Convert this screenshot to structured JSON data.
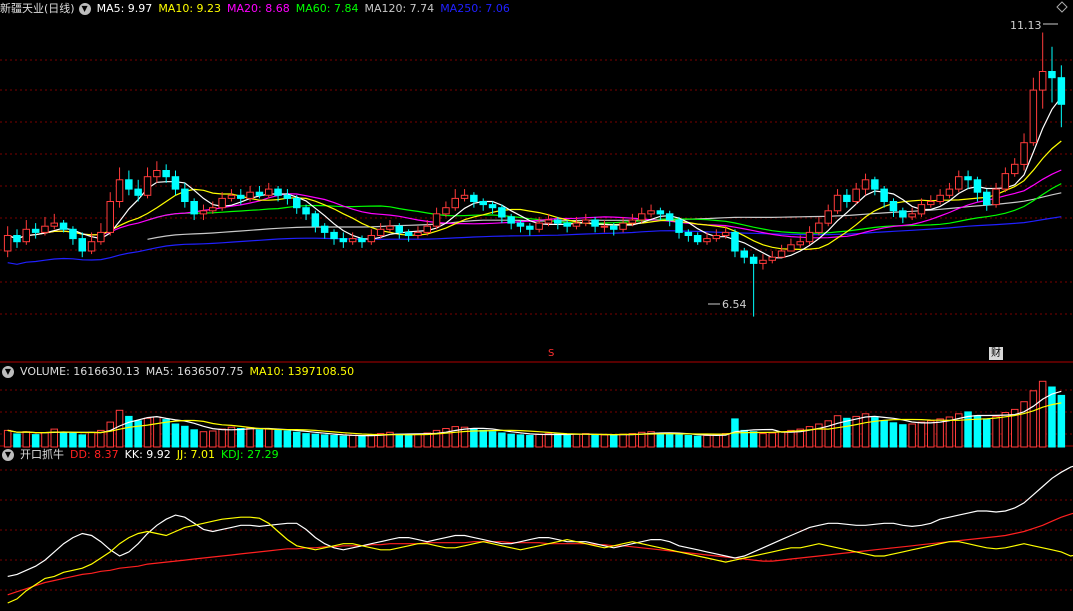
{
  "colors": {
    "background": "#000000",
    "up": "#ff3b3b",
    "down": "#00ffff",
    "grid": "#7a0000",
    "ma5": "#ffffff",
    "ma10": "#ffff00",
    "ma20": "#ff00ff",
    "ma60": "#00ff00",
    "ma120": "#c8c8c8",
    "ma250": "#2020ff",
    "kdj_dd": "#ff2020",
    "kdj_kk": "#ffffff",
    "kdj_jj": "#ffff00",
    "kdj_kdj": "#00ff00"
  },
  "price_panel": {
    "stock_name": "新疆天业(日线)",
    "collapse_icon": "chevron-down-icon",
    "ma_labels": [
      {
        "key": "ma5",
        "text": "MA5: 9.97"
      },
      {
        "key": "ma10",
        "text": "MA10: 9.23"
      },
      {
        "key": "ma20",
        "text": "MA20: 8.68"
      },
      {
        "key": "ma60",
        "text": "MA60: 7.84"
      },
      {
        "key": "ma120",
        "text": "MA120: 7.74"
      },
      {
        "key": "ma250",
        "text": "MA250: 7.06"
      }
    ],
    "high_label": "11.13",
    "low_label": "6.54",
    "marker_s": "S",
    "marker_finance": "财"
  },
  "volume_panel": {
    "labels": [
      {
        "key": "vol",
        "text": "VOLUME: 1616630.13"
      },
      {
        "key": "ma5",
        "text": "MA5: 1636507.75"
      },
      {
        "key": "ma10",
        "text": "MA10: 1397108.50"
      }
    ]
  },
  "indicator_panel": {
    "name": "开口抓牛",
    "labels": [
      {
        "key": "dd",
        "text": "DD: 8.37"
      },
      {
        "key": "kk",
        "text": "KK: 9.92"
      },
      {
        "key": "jj",
        "text": "JJ: 7.01"
      },
      {
        "key": "kdj",
        "text": "KDJ: 27.29"
      }
    ]
  },
  "chart_data": [
    {
      "type": "candlestick",
      "ylim": [
        6.0,
        11.3
      ],
      "count": 102,
      "close": [
        7.85,
        7.75,
        7.95,
        7.9,
        8.0,
        8.05,
        7.95,
        7.8,
        7.6,
        7.75,
        7.9,
        8.4,
        8.75,
        8.6,
        8.5,
        8.8,
        8.9,
        8.8,
        8.6,
        8.4,
        8.2,
        8.25,
        8.3,
        8.45,
        8.5,
        8.45,
        8.55,
        8.5,
        8.6,
        8.5,
        8.45,
        8.3,
        8.2,
        8.0,
        7.9,
        7.8,
        7.75,
        7.8,
        7.75,
        7.85,
        7.95,
        8.0,
        7.9,
        7.85,
        7.9,
        8.0,
        8.2,
        8.3,
        8.45,
        8.5,
        8.4,
        8.35,
        8.3,
        8.15,
        8.05,
        8.0,
        7.95,
        8.05,
        8.1,
        8.05,
        8.0,
        8.05,
        8.1,
        8.0,
        8.0,
        7.95,
        8.05,
        8.1,
        8.2,
        8.25,
        8.2,
        8.1,
        7.9,
        7.85,
        7.75,
        7.8,
        7.85,
        7.9,
        7.6,
        7.5,
        7.4,
        7.45,
        7.5,
        7.6,
        7.7,
        7.75,
        7.9,
        8.05,
        8.25,
        8.5,
        8.4,
        8.6,
        8.75,
        8.6,
        8.4,
        8.25,
        8.15,
        8.2,
        8.35,
        8.4,
        8.5,
        8.6,
        8.8,
        8.75,
        8.55,
        8.35,
        8.6,
        8.85,
        9.0,
        9.35,
        10.2,
        10.5,
        10.4,
        9.97
      ],
      "open": [
        7.6,
        7.85,
        7.75,
        7.95,
        7.9,
        8.0,
        8.05,
        7.95,
        7.8,
        7.6,
        7.75,
        7.9,
        8.4,
        8.75,
        8.6,
        8.5,
        8.8,
        8.9,
        8.8,
        8.6,
        8.4,
        8.2,
        8.25,
        8.3,
        8.45,
        8.5,
        8.45,
        8.55,
        8.5,
        8.6,
        8.5,
        8.45,
        8.3,
        8.2,
        8.0,
        7.9,
        7.8,
        7.75,
        7.8,
        7.75,
        7.85,
        7.95,
        8.0,
        7.9,
        7.85,
        7.9,
        8.0,
        8.2,
        8.3,
        8.45,
        8.5,
        8.4,
        8.35,
        8.3,
        8.15,
        8.05,
        8.0,
        7.95,
        8.05,
        8.1,
        8.05,
        8.0,
        8.05,
        8.1,
        8.0,
        8.0,
        7.95,
        8.05,
        8.1,
        8.2,
        8.25,
        8.2,
        8.1,
        7.9,
        7.85,
        7.75,
        7.8,
        7.85,
        7.9,
        7.6,
        7.5,
        7.4,
        7.45,
        7.5,
        7.6,
        7.7,
        7.75,
        7.9,
        8.05,
        8.25,
        8.5,
        8.4,
        8.6,
        8.75,
        8.6,
        8.4,
        8.25,
        8.15,
        8.2,
        8.35,
        8.4,
        8.5,
        8.6,
        8.8,
        8.75,
        8.55,
        8.35,
        8.6,
        8.85,
        9.0,
        9.35,
        10.2,
        10.5,
        10.4
      ],
      "high": [
        8.0,
        7.95,
        8.1,
        8.05,
        8.15,
        8.2,
        8.1,
        8.0,
        7.9,
        7.9,
        8.05,
        8.55,
        8.95,
        8.9,
        8.75,
        8.95,
        9.05,
        9.0,
        8.9,
        8.7,
        8.45,
        8.35,
        8.4,
        8.55,
        8.6,
        8.6,
        8.65,
        8.65,
        8.7,
        8.65,
        8.6,
        8.5,
        8.35,
        8.25,
        8.05,
        7.95,
        7.9,
        7.9,
        7.85,
        7.95,
        8.05,
        8.1,
        8.05,
        7.95,
        8.0,
        8.1,
        8.3,
        8.4,
        8.6,
        8.6,
        8.55,
        8.45,
        8.4,
        8.35,
        8.2,
        8.1,
        8.05,
        8.15,
        8.2,
        8.15,
        8.1,
        8.15,
        8.2,
        8.15,
        8.1,
        8.05,
        8.15,
        8.2,
        8.3,
        8.35,
        8.3,
        8.25,
        8.15,
        7.95,
        7.9,
        7.9,
        7.95,
        8.0,
        7.95,
        7.65,
        7.55,
        7.55,
        7.6,
        7.7,
        7.8,
        7.85,
        8.0,
        8.15,
        8.35,
        8.6,
        8.6,
        8.7,
        8.85,
        8.8,
        8.65,
        8.45,
        8.3,
        8.3,
        8.45,
        8.5,
        8.6,
        8.7,
        8.9,
        8.9,
        8.8,
        8.6,
        8.7,
        8.95,
        9.1,
        9.5,
        10.4,
        11.13,
        10.9,
        10.6
      ],
      "low": [
        7.5,
        7.65,
        7.7,
        7.8,
        7.85,
        7.95,
        7.9,
        7.7,
        7.5,
        7.55,
        7.7,
        7.85,
        8.3,
        8.5,
        8.4,
        8.45,
        8.7,
        8.7,
        8.5,
        8.3,
        8.1,
        8.1,
        8.2,
        8.25,
        8.4,
        8.35,
        8.4,
        8.45,
        8.45,
        8.4,
        8.35,
        8.2,
        8.1,
        7.9,
        7.8,
        7.7,
        7.65,
        7.7,
        7.65,
        7.7,
        7.8,
        7.9,
        7.8,
        7.75,
        7.8,
        7.85,
        7.95,
        8.15,
        8.25,
        8.4,
        8.3,
        8.25,
        8.2,
        8.05,
        7.95,
        7.9,
        7.85,
        7.9,
        8.0,
        7.95,
        7.9,
        7.95,
        8.0,
        7.9,
        7.9,
        7.85,
        7.9,
        8.0,
        8.05,
        8.15,
        8.1,
        8.0,
        7.8,
        7.75,
        7.7,
        7.7,
        7.75,
        7.8,
        7.5,
        7.4,
        6.54,
        7.3,
        7.4,
        7.5,
        7.6,
        7.65,
        7.7,
        7.85,
        8.0,
        8.2,
        8.3,
        8.35,
        8.5,
        8.5,
        8.3,
        8.15,
        8.05,
        8.1,
        8.15,
        8.3,
        8.35,
        8.45,
        8.55,
        8.6,
        8.4,
        8.25,
        8.3,
        8.55,
        8.8,
        8.9,
        9.3,
        9.9,
        10.0,
        9.6
      ]
    },
    {
      "type": "bar",
      "series_name": "VOLUME",
      "ylim": [
        0,
        2100000
      ],
      "values": [
        520000,
        410000,
        480000,
        390000,
        450000,
        560000,
        470000,
        430000,
        380000,
        460000,
        520000,
        780000,
        1150000,
        960000,
        820000,
        900000,
        940000,
        860000,
        720000,
        650000,
        540000,
        480000,
        500000,
        560000,
        620000,
        580000,
        600000,
        540000,
        560000,
        520000,
        500000,
        460000,
        420000,
        400000,
        380000,
        360000,
        340000,
        360000,
        340000,
        380000,
        420000,
        460000,
        400000,
        380000,
        400000,
        440000,
        520000,
        580000,
        640000,
        620000,
        560000,
        520000,
        480000,
        440000,
        400000,
        380000,
        360000,
        400000,
        420000,
        400000,
        380000,
        400000,
        420000,
        380000,
        380000,
        360000,
        400000,
        420000,
        460000,
        480000,
        440000,
        420000,
        380000,
        360000,
        340000,
        360000,
        380000,
        420000,
        880000,
        520000,
        480000,
        420000,
        440000,
        480000,
        520000,
        560000,
        640000,
        720000,
        820000,
        980000,
        900000,
        960000,
        1040000,
        920000,
        820000,
        760000,
        700000,
        720000,
        780000,
        820000,
        880000,
        940000,
        1040000,
        1100000,
        980000,
        880000,
        960000,
        1080000,
        1180000,
        1420000,
        1760000,
        2060000,
        1880000,
        1616630
      ]
    },
    {
      "type": "line",
      "title": "开口抓牛",
      "ylim": [
        0,
        100
      ],
      "series": [
        {
          "name": "DD",
          "values": [
            10,
            13,
            16,
            19,
            22,
            24,
            26,
            28,
            30,
            31,
            33,
            34,
            36,
            37,
            38,
            40,
            41,
            42,
            43,
            44,
            45,
            46,
            47,
            48,
            49,
            50,
            51,
            52,
            53,
            54,
            55,
            55,
            56,
            56,
            57,
            57,
            58,
            58,
            58,
            59,
            59,
            60,
            60,
            60,
            60,
            61,
            61,
            61,
            61,
            61,
            62,
            62,
            62,
            62,
            61,
            61,
            61,
            61,
            60,
            60,
            60,
            60,
            60,
            59,
            59,
            58,
            58,
            57,
            56,
            55,
            54,
            53,
            52,
            51,
            50,
            49,
            48,
            47,
            46,
            45,
            44,
            43,
            43,
            44,
            45,
            46,
            47,
            48,
            49,
            50,
            51,
            52,
            53,
            54,
            55,
            56,
            57,
            58,
            59,
            60,
            61,
            62,
            63,
            64,
            65,
            66,
            67,
            68,
            70,
            72,
            75,
            78,
            82,
            86,
            89,
            92
          ]
        },
        {
          "name": "KK",
          "values": [
            28,
            30,
            34,
            38,
            44,
            52,
            60,
            66,
            70,
            68,
            62,
            54,
            48,
            52,
            60,
            70,
            78,
            84,
            88,
            86,
            80,
            74,
            72,
            74,
            76,
            78,
            78,
            77,
            78,
            79,
            80,
            80,
            74,
            66,
            60,
            56,
            54,
            56,
            58,
            60,
            62,
            64,
            66,
            66,
            64,
            62,
            64,
            66,
            68,
            68,
            66,
            64,
            62,
            60,
            60,
            62,
            64,
            66,
            66,
            64,
            62,
            62,
            62,
            60,
            58,
            56,
            58,
            60,
            62,
            64,
            64,
            62,
            58,
            56,
            54,
            52,
            50,
            48,
            46,
            48,
            52,
            56,
            60,
            64,
            68,
            72,
            76,
            78,
            80,
            80,
            79,
            78,
            78,
            79,
            80,
            80,
            78,
            77,
            78,
            80,
            84,
            86,
            88,
            90,
            92,
            92,
            91,
            92,
            95,
            100,
            108,
            116,
            124,
            130,
            135,
            138
          ]
        },
        {
          "name": "JJ",
          "values": [
            2,
            6,
            14,
            20,
            26,
            28,
            32,
            34,
            36,
            40,
            46,
            52,
            60,
            66,
            70,
            72,
            70,
            68,
            72,
            76,
            78,
            80,
            82,
            84,
            85,
            86,
            86,
            85,
            80,
            72,
            64,
            58,
            56,
            54,
            56,
            58,
            60,
            60,
            58,
            56,
            54,
            54,
            56,
            58,
            60,
            60,
            58,
            56,
            56,
            58,
            60,
            62,
            60,
            58,
            56,
            54,
            56,
            58,
            60,
            62,
            64,
            62,
            60,
            58,
            56,
            58,
            60,
            62,
            60,
            58,
            56,
            54,
            52,
            50,
            48,
            46,
            44,
            42,
            44,
            46,
            48,
            50,
            52,
            54,
            56,
            56,
            58,
            60,
            58,
            56,
            54,
            52,
            50,
            48,
            48,
            50,
            52,
            54,
            56,
            58,
            60,
            62,
            62,
            60,
            58,
            56,
            55,
            56,
            58,
            60,
            58,
            56,
            54,
            52,
            48,
            50
          ]
        }
      ]
    }
  ]
}
